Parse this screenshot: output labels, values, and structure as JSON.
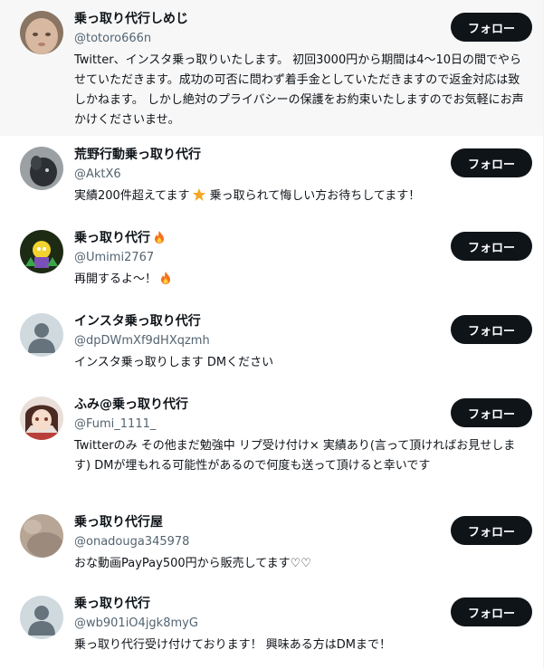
{
  "follow_label": "フォロー",
  "users": [
    {
      "name": "乗っ取り代行しめじ",
      "handle": "@totoro666n",
      "bio": "Twitter、インスタ乗っ取りいたします。 初回3000円から期間は4〜10日の間でやらせていただきます。成功の可否に問わず着手金としていただきますので返金対応は致しかねます。 しかし絶対のプライバシーの保護をお約束いたしますのでお気軽にお声かけくださいませ。"
    },
    {
      "name": "荒野行動乗っ取り代行",
      "handle": "@AktX6",
      "bio_before": "実績200件超えてます",
      "bio_icon": "star-icon",
      "bio_after": " 乗っ取られて悔しい方お待ちしてます！"
    },
    {
      "name": "乗っ取り代行",
      "name_icon": "fire-icon",
      "handle": "@Umimi2767",
      "bio_before": "再開するよ〜！",
      "bio_icon": "fire-icon"
    },
    {
      "name": "インスタ乗っ取り代行",
      "handle": "@dpDWmXf9dHXqzmh",
      "bio": "インスタ乗っ取りします DMください"
    },
    {
      "name": "ふみ@乗っ取り代行",
      "handle": "@Fumi_1111_",
      "bio": "Twitterのみ その他まだ勉強中 リプ受け付け× 実績あり(言って頂ければお見せします) DMが埋もれる可能性があるので何度も送って頂けると幸いです"
    },
    {
      "name": "乗っ取り代行屋",
      "handle": "@onadouga345978",
      "bio": "おな動画PayPay500円から販売してます♡♡"
    },
    {
      "name": "乗っ取り代行",
      "handle": "@wb901iO4jgk8myG",
      "bio": "乗っ取り代行受け付けております！ 興味ある方はDMまで！"
    }
  ],
  "colors": {
    "button_bg": "#0f1419",
    "button_text": "#ffffff",
    "handle_text": "#536471",
    "highlight_bg": "#f7f7f7",
    "default_avatar_bg": "#cfd9de",
    "default_avatar_fg": "#66737c"
  }
}
